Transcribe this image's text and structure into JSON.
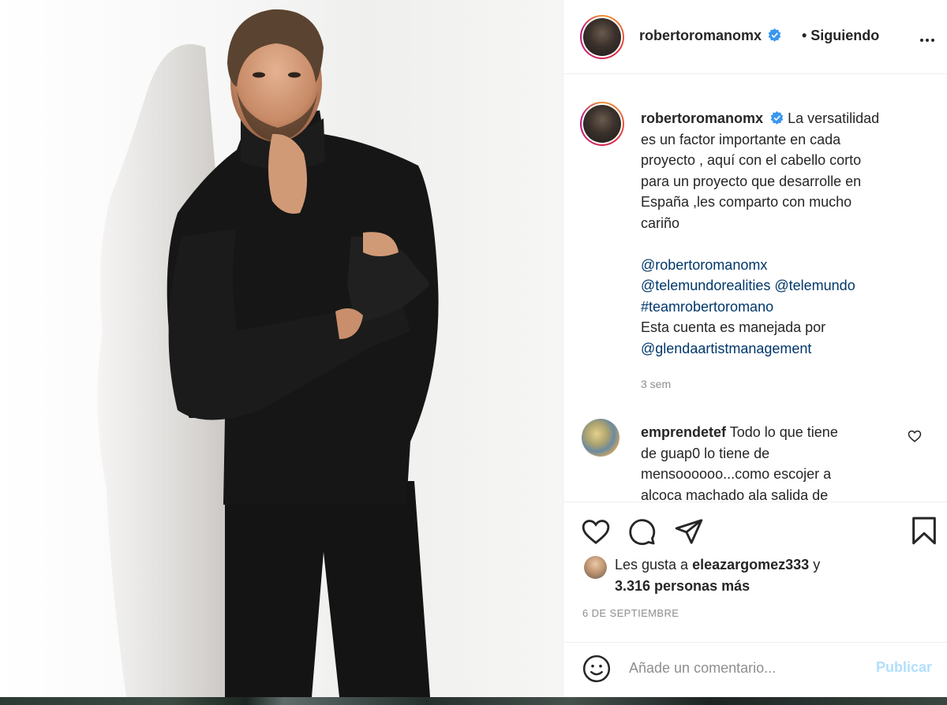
{
  "post": {
    "username": "robertoromanomx",
    "follow_status": "• Siguiendo",
    "caption_text_lines": [
      "La versatilidad",
      "es un factor importante en cada",
      "proyecto , aquí con el cabello corto",
      "para un proyecto que desarrolle en",
      "España ,les comparto con mucho",
      "cariño"
    ],
    "mention_1": "@robertoromanomx",
    "mention_2": "@telemundorealities",
    "mention_3": "@telemundo",
    "hashtag": "#teamrobertoromano",
    "managed_text": "Esta cuenta es manejada por",
    "mention_4": "@glendaartistmanagement",
    "time_ago": "3 sem"
  },
  "comment": {
    "username": "emprendetef",
    "text_lines": [
      "Todo lo que tiene",
      "de guap0 lo tiene de",
      "mensoooooo...como escojer a",
      "alcoca machado ala salida de"
    ]
  },
  "likes": {
    "prefix": "Les gusta a",
    "liker": "eleazargomez333",
    "conj": "y",
    "others": "3.316 personas más"
  },
  "date": "6 DE SEPTIEMBRE",
  "comment_box": {
    "placeholder": "Añade un comentario...",
    "publish_label": "Publicar"
  },
  "icons": {
    "header": [
      "verified-badge-icon",
      "more-options-icon"
    ],
    "actions": [
      "heart-icon",
      "comment-icon",
      "share-icon",
      "bookmark-icon"
    ],
    "comment_box": [
      "emoji-icon"
    ]
  },
  "colors": {
    "link": "#00376b",
    "verified": "#3897f0",
    "publish_disabled": "#b2dffc",
    "muted": "#8e8e8e"
  }
}
